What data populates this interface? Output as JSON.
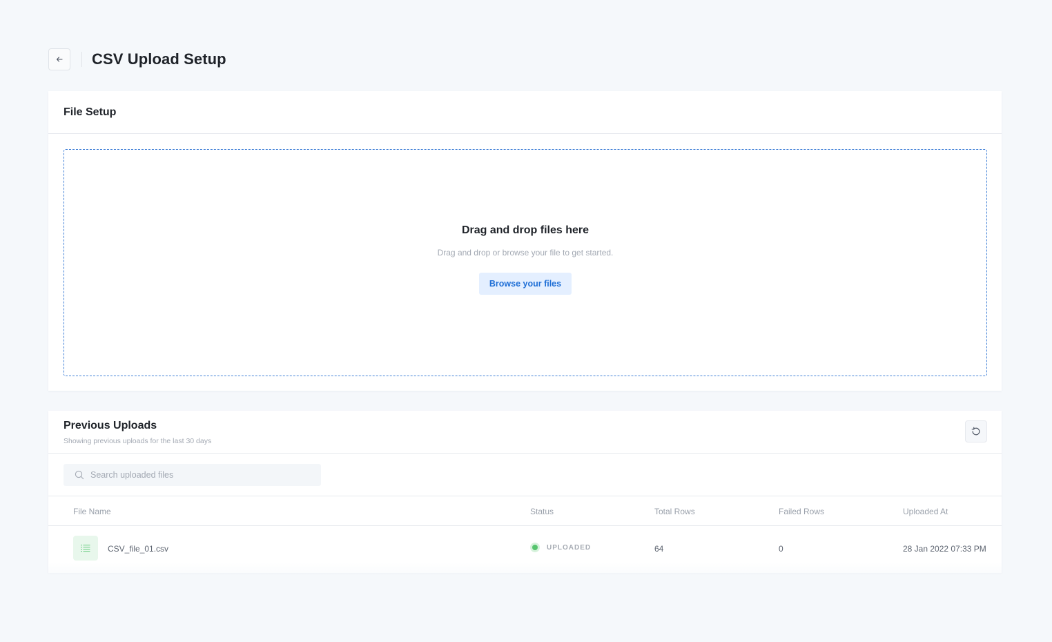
{
  "header": {
    "title": "CSV Upload Setup",
    "back_icon": "arrow-left-icon"
  },
  "file_setup": {
    "title": "File Setup",
    "dropzone": {
      "title": "Drag and drop files here",
      "subtitle": "Drag and drop or browse your file to get started.",
      "browse_label": "Browse your files"
    },
    "accent_color": "#3f7fd6"
  },
  "previous_uploads": {
    "title": "Previous Uploads",
    "subtitle": "Showing previous uploads for the last 30 days",
    "refresh_icon": "refresh-icon",
    "search": {
      "placeholder": "Search uploaded files",
      "value": ""
    },
    "columns": {
      "file_name": "File Name",
      "status": "Status",
      "total_rows": "Total Rows",
      "failed_rows": "Failed Rows",
      "uploaded_at": "Uploaded At"
    },
    "rows": [
      {
        "file_name": "CSV_file_01.csv",
        "status": "UPLOADED",
        "status_color": "#56c46e",
        "total_rows": "64",
        "failed_rows": "0",
        "uploaded_at": "28 Jan 2022 07:33 PM"
      }
    ]
  }
}
